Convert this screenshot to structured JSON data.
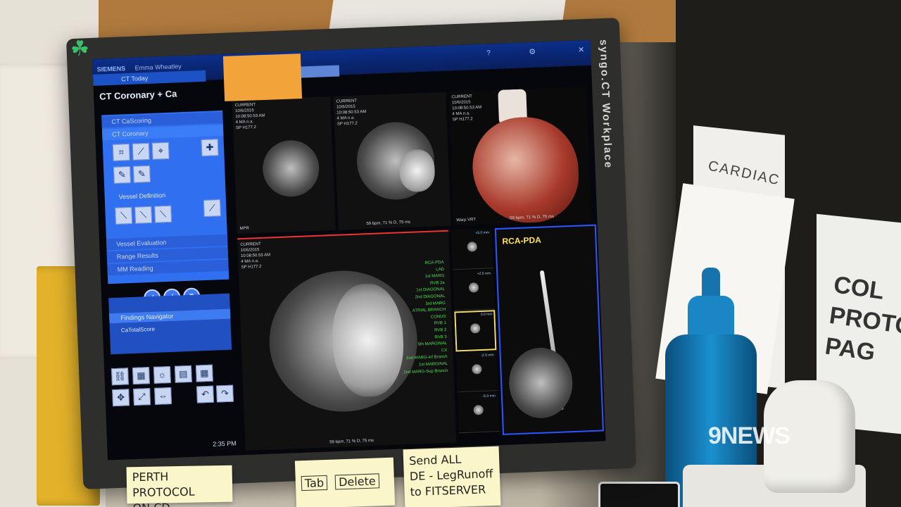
{
  "screen": {
    "brand": "SIEMENS",
    "user": "Emma Wheatley",
    "tab_ct_today": "CT Today",
    "workspace_title": "CT Coronary + Ca",
    "vertical_brand": "syngo.CT Workplace",
    "panel_rows": [
      "CT CaScoring",
      "CT Coronary"
    ],
    "vessel_definition": "Vessel Definition",
    "vessel_evaluation": "Vessel Evaluation",
    "range_results": "Range Results",
    "mm_reading": "MM Reading",
    "findings_navigator": "Findings Navigator",
    "findings_row": "CaTotalScore",
    "clock": "2:35 PM",
    "pane_current": "CURRENT",
    "pane_date": "10/6/2015",
    "pane_time": "10:08:50.53 AM",
    "pane_ma": "4 MA n.a.",
    "pane_sp": "SP H177.2",
    "pane_foot": "59 bpm, 71 % D, 75 ms",
    "pane_mpr": "MPR",
    "pane_warp": "Warp VRT",
    "rca_label": "RCA-PDA",
    "vessels": [
      "RCA-PDA",
      "LAD",
      "1st MARG",
      "RVB 2a",
      "1st DIAGONAL",
      "2nd DIAGONAL",
      "3rd MARG",
      "ATRIAL BRANCH",
      "CONUS",
      "RVB 1",
      "RVB 2",
      "RVB 3",
      "5th MARGINAL",
      "CX",
      "2nd MARG-inf Branch",
      "1st MARGINAL",
      "2nd MARG-Sup Branch"
    ],
    "thumb_mm": [
      "+5.0 mm",
      "+2.5 mm",
      "0.0 mm",
      "-2.5 mm",
      "-5.0 mm"
    ],
    "icons": [
      "help-icon",
      "close-icon",
      "settings-icon"
    ]
  },
  "notes": {
    "perth": [
      "PERTH PROTOCOL",
      "ON CD"
    ],
    "tab": [
      "Tab",
      "Delete"
    ],
    "send": [
      "Send ALL",
      "DE - LegRunoff",
      "to FITSERVER"
    ]
  },
  "background": {
    "card_text": "CARDIAC",
    "binder_label": [
      "COL",
      "PROTO",
      "PAG"
    ]
  },
  "watermark": "9NEWS"
}
